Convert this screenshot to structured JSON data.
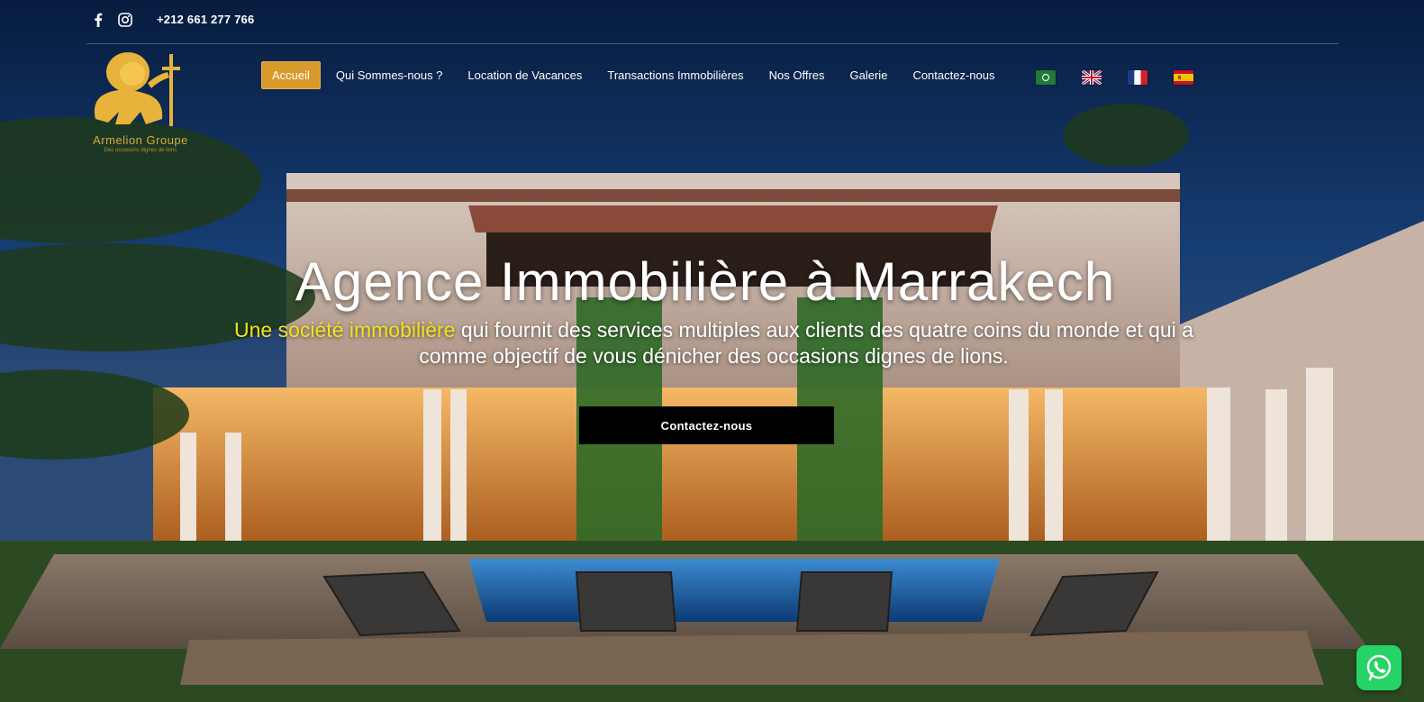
{
  "topbar": {
    "facebook_icon": "facebook-icon",
    "instagram_icon": "instagram-icon",
    "phone": "+212 661 277 766"
  },
  "logo": {
    "name": "Armelion Groupe",
    "tagline": "Des occasions dignes de lions"
  },
  "nav": {
    "items": [
      {
        "label": "Accueil",
        "active": true
      },
      {
        "label": "Qui Sommes-nous ?",
        "active": false
      },
      {
        "label": "Location de Vacances",
        "active": false
      },
      {
        "label": "Transactions Immobilières",
        "active": false
      },
      {
        "label": "Nos Offres",
        "active": false
      },
      {
        "label": "Galerie",
        "active": false
      },
      {
        "label": "Contactez-nous",
        "active": false
      }
    ],
    "languages": [
      "Arabic",
      "English",
      "French",
      "Spanish"
    ]
  },
  "hero": {
    "title": "Agence Immobilière à Marrakech",
    "highlight": "Une société immobilière",
    "description": " qui fournit des services multiples aux clients des quatre coins du monde et qui a comme objectif de vous dénicher des occasions dignes de lions.",
    "cta_label": "Contactez-nous"
  },
  "colors": {
    "accent": "#d99a2b",
    "highlight": "#f3e21e",
    "whatsapp": "#25d366"
  },
  "whatsapp_icon": "whatsapp-icon"
}
